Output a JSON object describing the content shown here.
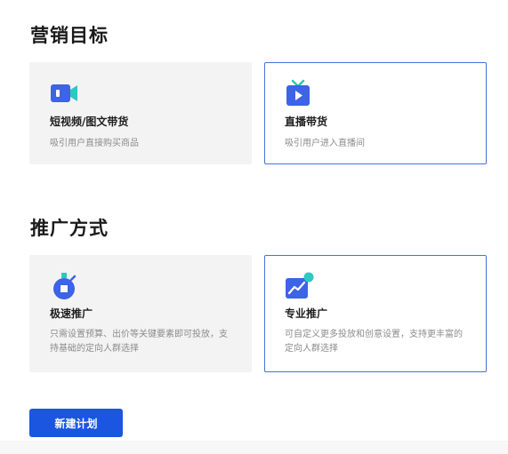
{
  "sections": {
    "goal": {
      "title": "营销目标",
      "cards": [
        {
          "icon": "video-camera-icon",
          "title": "短视频/图文带货",
          "desc": "吸引用户直接购买商品",
          "selected": false
        },
        {
          "icon": "tv-play-icon",
          "title": "直播带货",
          "desc": "吸引用户进入直播间",
          "selected": true
        }
      ]
    },
    "mode": {
      "title": "推广方式",
      "cards": [
        {
          "icon": "speed-rocket-icon",
          "title": "极速推广",
          "desc": "只需设置预算、出价等关键要素即可投放，支持基础的定向人群选择",
          "selected": false
        },
        {
          "icon": "trend-chart-icon",
          "title": "专业推广",
          "desc": "可自定义更多投放和创意设置，支持更丰富的定向人群选择",
          "selected": true
        }
      ]
    }
  },
  "actions": {
    "create_label": "新建计划"
  },
  "colors": {
    "accent": "#1a56e0",
    "selected_border": "#4a6fd8",
    "card_bg": "#f3f3f3",
    "muted_text": "#8c8c8c"
  }
}
